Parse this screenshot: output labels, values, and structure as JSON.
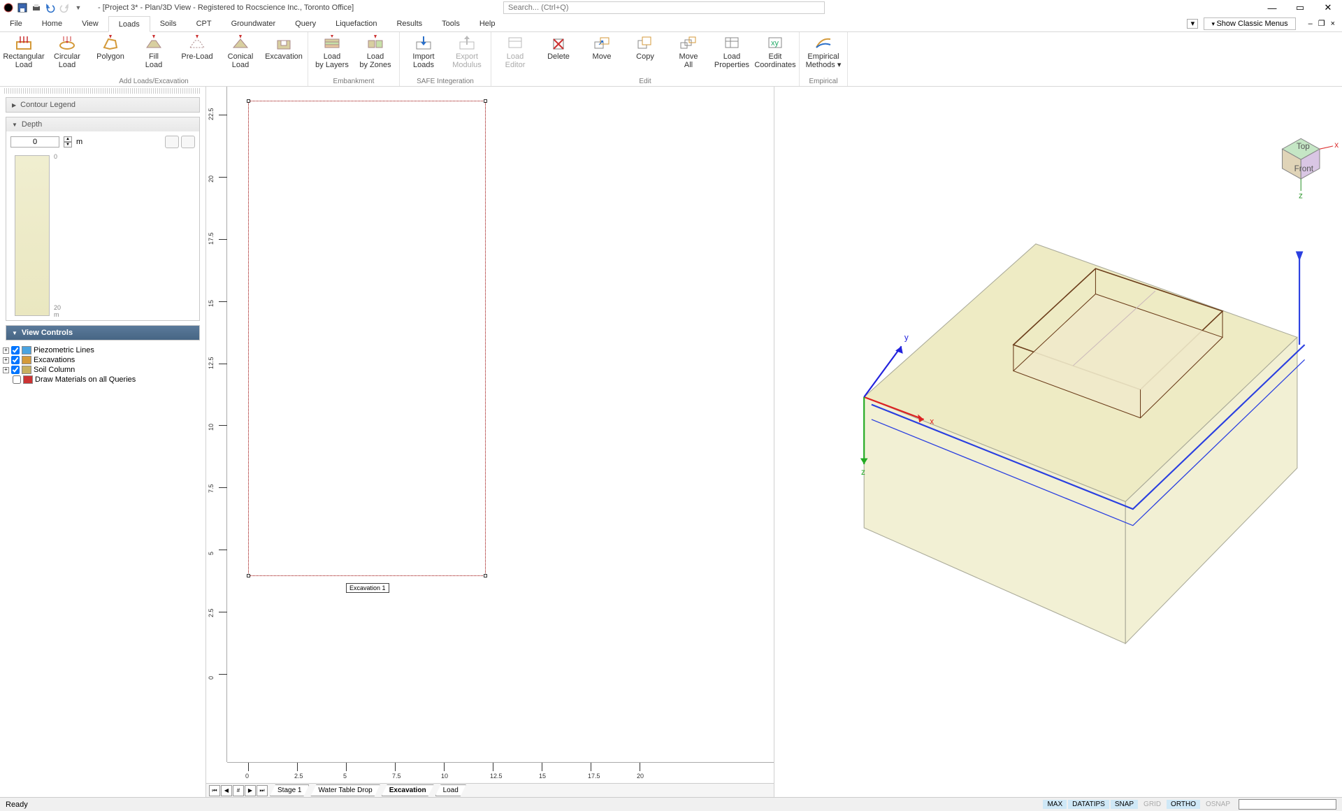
{
  "title": "- [Project 3* - Plan/3D View - Registered to Rocscience Inc., Toronto Office]",
  "searchPlaceholder": "Search... (Ctrl+Q)",
  "classicMenus": "Show Classic Menus",
  "menuTabs": [
    "File",
    "Home",
    "View",
    "Loads",
    "Soils",
    "CPT",
    "Groundwater",
    "Query",
    "Liquefaction",
    "Results",
    "Tools",
    "Help"
  ],
  "activeMenuTab": "Loads",
  "ribbon": {
    "groups": [
      {
        "label": "Add Loads/Excavation",
        "items": [
          {
            "name": "rectangular-load",
            "label": "Rectangular Load"
          },
          {
            "name": "circular-load",
            "label": "Circular Load"
          },
          {
            "name": "polygon",
            "label": "Polygon"
          },
          {
            "name": "fill-load",
            "label": "Fill Load"
          },
          {
            "name": "pre-load",
            "label": "Pre-Load"
          },
          {
            "name": "conical-load",
            "label": "Conical Load"
          },
          {
            "name": "excavation",
            "label": "Excavation"
          }
        ]
      },
      {
        "label": "Embankment",
        "items": [
          {
            "name": "load-by-layers",
            "label": "Load by Layers"
          },
          {
            "name": "load-by-zones",
            "label": "Load by Zones"
          }
        ]
      },
      {
        "label": "SAFE Integeration",
        "items": [
          {
            "name": "import-loads",
            "label": "Import Loads"
          },
          {
            "name": "export-modulus",
            "label": "Export Modulus",
            "disabled": true
          }
        ]
      },
      {
        "label": "Edit",
        "items": [
          {
            "name": "load-editor",
            "label": "Load Editor",
            "disabled": true
          },
          {
            "name": "delete",
            "label": "Delete"
          },
          {
            "name": "move",
            "label": "Move"
          },
          {
            "name": "copy",
            "label": "Copy"
          },
          {
            "name": "move-all",
            "label": "Move All"
          },
          {
            "name": "load-properties",
            "label": "Load Properties"
          },
          {
            "name": "edit-coordinates",
            "label": "Edit Coordinates"
          }
        ]
      },
      {
        "label": "Empirical",
        "items": [
          {
            "name": "empirical-methods",
            "label": "Empirical Methods ▾"
          }
        ]
      }
    ]
  },
  "sidepanel": {
    "contourLegend": "Contour Legend",
    "depth": "Depth",
    "depthValue": "0",
    "depthUnit": "m",
    "gaugeTop": "0",
    "gaugeBottom": "20 m",
    "viewControls": "View Controls",
    "tree": [
      {
        "label": "Piezometric Lines",
        "checked": true,
        "icon": "piezo"
      },
      {
        "label": "Excavations",
        "checked": true,
        "icon": "excav"
      },
      {
        "label": "Soil Column",
        "checked": true,
        "icon": "soil"
      },
      {
        "label": "Draw Materials on all Queries",
        "checked": false,
        "icon": "draw",
        "noexpand": true
      }
    ]
  },
  "plan": {
    "excavationLabel": "Excavation 1",
    "yTicks": [
      "0",
      "2.5",
      "5",
      "7.5",
      "10",
      "12.5",
      "15",
      "17.5",
      "20",
      "22.5"
    ],
    "xTicks": [
      "0",
      "2.5",
      "5",
      "7.5",
      "10",
      "12.5",
      "15",
      "17.5",
      "20"
    ],
    "stageTabs": [
      "Stage 1",
      "Water Table Drop",
      "Excavation",
      "Load"
    ],
    "activeStageTab": "Excavation"
  },
  "axes3d": {
    "x": "x",
    "y": "y",
    "z": "z"
  },
  "status": {
    "ready": "Ready",
    "tags": [
      {
        "t": "MAX",
        "on": true
      },
      {
        "t": "DATATIPS",
        "on": true
      },
      {
        "t": "SNAP",
        "on": true
      },
      {
        "t": "GRID",
        "on": false
      },
      {
        "t": "ORTHO",
        "on": true
      },
      {
        "t": "OSNAP",
        "on": false
      }
    ]
  }
}
